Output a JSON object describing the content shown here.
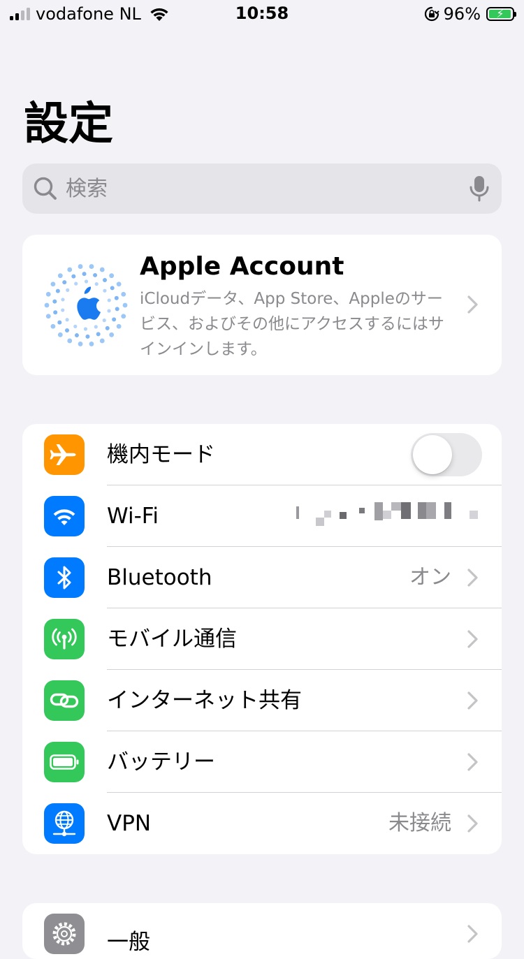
{
  "status_bar": {
    "carrier": "vodafone NL",
    "time": "10:58",
    "battery_percent": "96%",
    "battery_level": 0.96,
    "battery_charging": true
  },
  "page": {
    "title": "設定"
  },
  "search": {
    "placeholder": "検索",
    "value": ""
  },
  "account": {
    "title": "Apple Account",
    "description": "iCloudデータ、App Store、Appleのサービス、およびその他にアクセスするにはサインインします。"
  },
  "settings": [
    {
      "key": "airplane",
      "label": "機内モード",
      "icon": "airplane-icon",
      "color": "#ff9500",
      "control": "toggle",
      "toggle_on": false
    },
    {
      "key": "wifi",
      "label": "Wi-Fi",
      "icon": "wifi-icon",
      "color": "#007aff",
      "value_redacted": true
    },
    {
      "key": "bluetooth",
      "label": "Bluetooth",
      "icon": "bluetooth-icon",
      "color": "#007aff",
      "value": "オン"
    },
    {
      "key": "cellular",
      "label": "モバイル通信",
      "icon": "cellular-antenna-icon",
      "color": "#34c759"
    },
    {
      "key": "hotspot",
      "label": "インターネット共有",
      "icon": "link-icon",
      "color": "#34c759"
    },
    {
      "key": "battery",
      "label": "バッテリー",
      "icon": "battery-icon",
      "color": "#34c759"
    },
    {
      "key": "vpn",
      "label": "VPN",
      "icon": "globe-network-icon",
      "color": "#007aff",
      "value": "未接続"
    }
  ],
  "general": {
    "label": "一般",
    "icon": "gear-icon",
    "color": "#8e8e93"
  },
  "colors": {
    "background": "#f2f2f7",
    "card": "#ffffff",
    "secondary_text": "#8a8a8e",
    "accent_blue": "#007aff",
    "green": "#34c759",
    "orange": "#ff9500"
  }
}
